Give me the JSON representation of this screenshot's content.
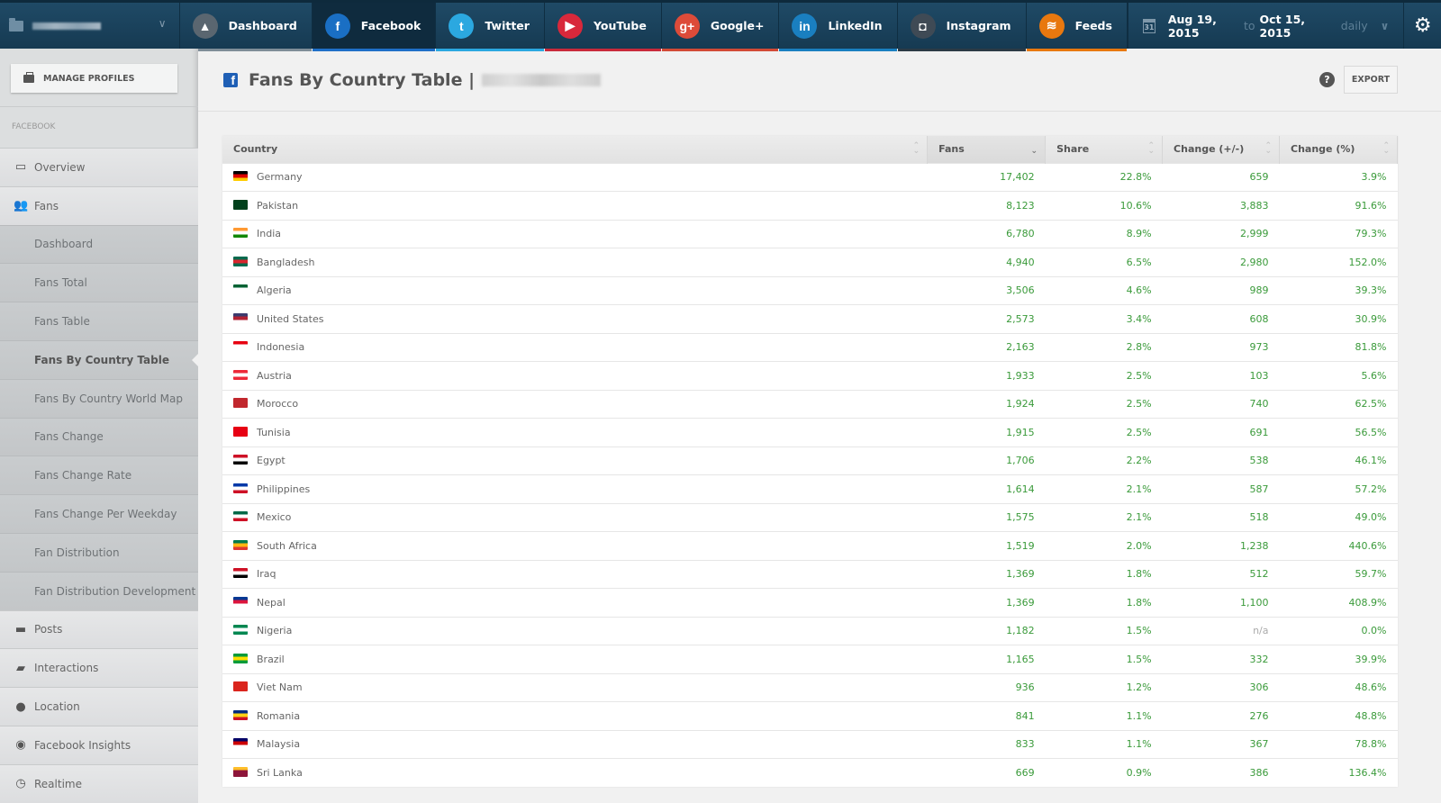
{
  "topbar": {
    "profile_name": "",
    "tabs": [
      {
        "label": "Dashboard",
        "icon": "chart-area-icon",
        "color": "#5a6670",
        "bar": "#7f8d98",
        "glyph": "▲"
      },
      {
        "label": "Facebook",
        "icon": "facebook-icon",
        "color": "#1a6fc4",
        "bar": "#1f6fc8",
        "glyph": "f"
      },
      {
        "label": "Twitter",
        "icon": "twitter-icon",
        "color": "#2ba8e0",
        "bar": "#2ba8e0",
        "glyph": "t"
      },
      {
        "label": "YouTube",
        "icon": "youtube-icon",
        "color": "#d8283b",
        "bar": "#c92a3b",
        "glyph": "▶"
      },
      {
        "label": "Google+",
        "icon": "google-plus-icon",
        "color": "#dd4b39",
        "bar": "#d24a36",
        "glyph": "g+"
      },
      {
        "label": "LinkedIn",
        "icon": "linkedin-icon",
        "color": "#1a7fc0",
        "bar": "#1a7fc0",
        "glyph": "in"
      },
      {
        "label": "Instagram",
        "icon": "instagram-icon",
        "color": "#3f4a55",
        "bar": "#2c3a45",
        "glyph": "◘"
      },
      {
        "label": "Feeds",
        "icon": "rss-icon",
        "color": "#e8780f",
        "bar": "#e8780f",
        "glyph": "≋"
      }
    ],
    "active_tab": "Facebook",
    "date_from": "Aug 19, 2015",
    "date_sep": "to",
    "date_to": "Oct 15, 2015",
    "calendar_day": "31",
    "granularity": "daily"
  },
  "sidebar": {
    "manage_profiles": "MANAGE PROFILES",
    "section": "FACEBOOK",
    "items": [
      {
        "label": "Overview",
        "icon": "monitor-icon",
        "glyph": "▭",
        "type": "main"
      },
      {
        "label": "Fans",
        "icon": "users-icon",
        "glyph": "👥",
        "type": "main"
      },
      {
        "label": "Dashboard",
        "type": "sub"
      },
      {
        "label": "Fans Total",
        "type": "sub"
      },
      {
        "label": "Fans Table",
        "type": "sub"
      },
      {
        "label": "Fans By Country Table",
        "type": "sub",
        "active": true
      },
      {
        "label": "Fans By Country World Map",
        "type": "sub"
      },
      {
        "label": "Fans Change",
        "type": "sub"
      },
      {
        "label": "Fans Change Rate",
        "type": "sub"
      },
      {
        "label": "Fans Change Per Weekday",
        "type": "sub"
      },
      {
        "label": "Fan Distribution",
        "type": "sub"
      },
      {
        "label": "Fan Distribution Development",
        "type": "sub"
      },
      {
        "label": "Posts",
        "icon": "comment-icon",
        "glyph": "▬",
        "type": "main"
      },
      {
        "label": "Interactions",
        "icon": "comments-icon",
        "glyph": "▰",
        "type": "main"
      },
      {
        "label": "Location",
        "icon": "map-pin-icon",
        "glyph": "●",
        "type": "main"
      },
      {
        "label": "Facebook Insights",
        "icon": "eye-icon",
        "glyph": "◉",
        "type": "main"
      },
      {
        "label": "Realtime",
        "icon": "clock-icon",
        "glyph": "◷",
        "type": "main"
      }
    ]
  },
  "page": {
    "title": "Fans By Country Table |",
    "help": "?",
    "export": "EXPORT"
  },
  "table": {
    "columns": [
      "Country",
      "Fans",
      "Share",
      "Change (+/-)",
      "Change (%)"
    ],
    "sorted_column": "Fans",
    "rows": [
      {
        "country": "Germany",
        "flag": [
          "#000",
          "#d00",
          "#fc0"
        ],
        "fans": "17,402",
        "share": "22.8%",
        "change": "659",
        "change_pct": "3.9%"
      },
      {
        "country": "Pakistan",
        "flag": [
          "#01411c",
          "#01411c",
          "#01411c"
        ],
        "fans": "8,123",
        "share": "10.6%",
        "change": "3,883",
        "change_pct": "91.6%"
      },
      {
        "country": "India",
        "flag": [
          "#f93",
          "#fff",
          "#128807"
        ],
        "fans": "6,780",
        "share": "8.9%",
        "change": "2,999",
        "change_pct": "79.3%"
      },
      {
        "country": "Bangladesh",
        "flag": [
          "#006a4e",
          "#d9262e",
          "#006a4e"
        ],
        "fans": "4,940",
        "share": "6.5%",
        "change": "2,980",
        "change_pct": "152.0%"
      },
      {
        "country": "Algeria",
        "flag": [
          "#006233",
          "#fff",
          "#fff"
        ],
        "fans": "3,506",
        "share": "4.6%",
        "change": "989",
        "change_pct": "39.3%"
      },
      {
        "country": "United States",
        "flag": [
          "#3c3b6e",
          "#b22234",
          "#fff"
        ],
        "fans": "2,573",
        "share": "3.4%",
        "change": "608",
        "change_pct": "30.9%"
      },
      {
        "country": "Indonesia",
        "flag": [
          "#e70011",
          "#fff",
          "#fff"
        ],
        "fans": "2,163",
        "share": "2.8%",
        "change": "973",
        "change_pct": "81.8%"
      },
      {
        "country": "Austria",
        "flag": [
          "#ed2939",
          "#fff",
          "#ed2939"
        ],
        "fans": "1,933",
        "share": "2.5%",
        "change": "103",
        "change_pct": "5.6%"
      },
      {
        "country": "Morocco",
        "flag": [
          "#c1272d",
          "#c1272d",
          "#c1272d"
        ],
        "fans": "1,924",
        "share": "2.5%",
        "change": "740",
        "change_pct": "62.5%"
      },
      {
        "country": "Tunisia",
        "flag": [
          "#e70013",
          "#e70013",
          "#e70013"
        ],
        "fans": "1,915",
        "share": "2.5%",
        "change": "691",
        "change_pct": "56.5%"
      },
      {
        "country": "Egypt",
        "flag": [
          "#ce1126",
          "#fff",
          "#000"
        ],
        "fans": "1,706",
        "share": "2.2%",
        "change": "538",
        "change_pct": "46.1%"
      },
      {
        "country": "Philippines",
        "flag": [
          "#0038a8",
          "#fff",
          "#ce1126"
        ],
        "fans": "1,614",
        "share": "2.1%",
        "change": "587",
        "change_pct": "57.2%"
      },
      {
        "country": "Mexico",
        "flag": [
          "#006847",
          "#fff",
          "#ce1126"
        ],
        "fans": "1,575",
        "share": "2.1%",
        "change": "518",
        "change_pct": "49.0%"
      },
      {
        "country": "South Africa",
        "flag": [
          "#007a4d",
          "#ffb612",
          "#de3831"
        ],
        "fans": "1,519",
        "share": "2.0%",
        "change": "1,238",
        "change_pct": "440.6%"
      },
      {
        "country": "Iraq",
        "flag": [
          "#ce1126",
          "#fff",
          "#000"
        ],
        "fans": "1,369",
        "share": "1.8%",
        "change": "512",
        "change_pct": "59.7%"
      },
      {
        "country": "Nepal",
        "flag": [
          "#003893",
          "#dc143c",
          "#fff"
        ],
        "fans": "1,369",
        "share": "1.8%",
        "change": "1,100",
        "change_pct": "408.9%"
      },
      {
        "country": "Nigeria",
        "flag": [
          "#008751",
          "#fff",
          "#008751"
        ],
        "fans": "1,182",
        "share": "1.5%",
        "change": "n/a",
        "change_pct": "0.0%"
      },
      {
        "country": "Brazil",
        "flag": [
          "#009b3a",
          "#fedf00",
          "#009b3a"
        ],
        "fans": "1,165",
        "share": "1.5%",
        "change": "332",
        "change_pct": "39.9%"
      },
      {
        "country": "Viet Nam",
        "flag": [
          "#da251d",
          "#da251d",
          "#da251d"
        ],
        "fans": "936",
        "share": "1.2%",
        "change": "306",
        "change_pct": "48.6%"
      },
      {
        "country": "Romania",
        "flag": [
          "#002b7f",
          "#fcd116",
          "#ce1126"
        ],
        "fans": "841",
        "share": "1.1%",
        "change": "276",
        "change_pct": "48.8%"
      },
      {
        "country": "Malaysia",
        "flag": [
          "#010066",
          "#cc0001",
          "#fff"
        ],
        "fans": "833",
        "share": "1.1%",
        "change": "367",
        "change_pct": "78.8%"
      },
      {
        "country": "Sri Lanka",
        "flag": [
          "#ffbe29",
          "#8d153a",
          "#8d153a"
        ],
        "fans": "669",
        "share": "0.9%",
        "change": "386",
        "change_pct": "136.4%"
      }
    ]
  },
  "colors": {
    "positive": "#3a9a3a",
    "topbar": "#1a4560",
    "na": "#aaaaaa"
  }
}
